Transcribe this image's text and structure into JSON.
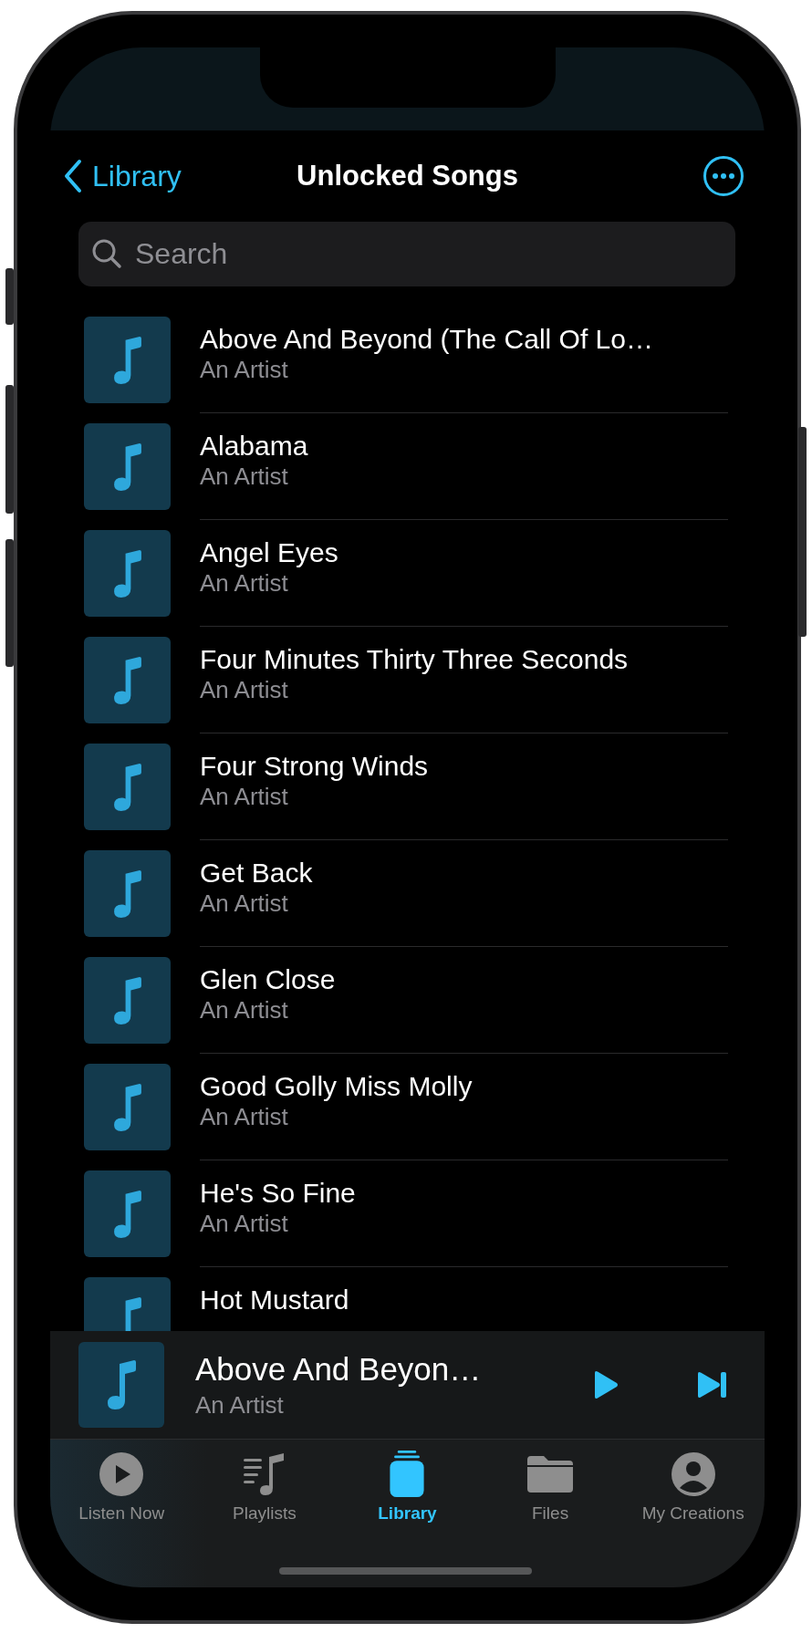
{
  "nav": {
    "back_label": "Library",
    "title": "Unlocked Songs"
  },
  "search": {
    "placeholder": "Search"
  },
  "songs": [
    {
      "title": "Above And Beyond (The Call Of Lo…",
      "artist": "An Artist"
    },
    {
      "title": "Alabama",
      "artist": "An Artist"
    },
    {
      "title": "Angel Eyes",
      "artist": "An Artist"
    },
    {
      "title": "Four Minutes Thirty Three Seconds",
      "artist": "An Artist"
    },
    {
      "title": "Four Strong Winds",
      "artist": "An Artist"
    },
    {
      "title": "Get Back",
      "artist": "An Artist"
    },
    {
      "title": "Glen Close",
      "artist": "An Artist"
    },
    {
      "title": "Good Golly Miss Molly",
      "artist": "An Artist"
    },
    {
      "title": "He's So Fine",
      "artist": "An Artist"
    },
    {
      "title": "Hot Mustard"
    }
  ],
  "now_playing": {
    "title": "Above And Beyon…",
    "artist": "An Artist"
  },
  "tabs": [
    {
      "label": "Listen Now",
      "kind": "play",
      "selected": false
    },
    {
      "label": "Playlists",
      "kind": "playlist",
      "selected": false
    },
    {
      "label": "Library",
      "kind": "library",
      "selected": true
    },
    {
      "label": "Files",
      "kind": "folder",
      "selected": false
    },
    {
      "label": "My Creations",
      "kind": "person",
      "selected": false
    }
  ]
}
